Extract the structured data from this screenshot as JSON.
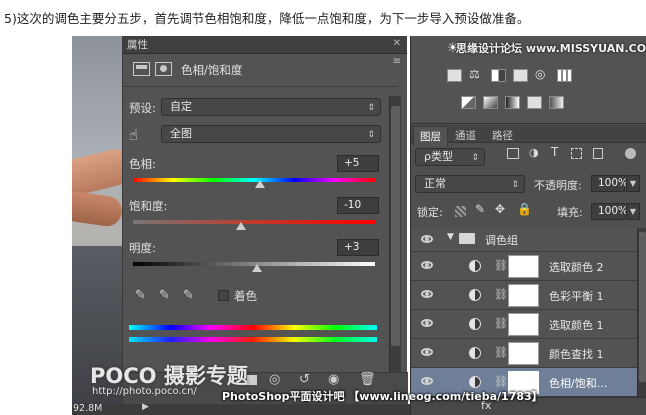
{
  "caption": "5)这次的调色主要分五步，首先调节色相饱和度，降低一点饱和度，为下一步导入预设做准备。",
  "properties_panel": {
    "title": "属性",
    "close": "✕",
    "menu": "≡",
    "adjustment_name": "色相/饱和度",
    "preset_label": "预设:",
    "preset_value": "自定",
    "channel_value": "全图",
    "hue_label": "色相:",
    "hue_value": "+5",
    "saturation_label": "饱和度:",
    "saturation_value": "-10",
    "lightness_label": "明度:",
    "lightness_value": "+3",
    "colorize_label": "着色"
  },
  "status": {
    "doc_size": "92.8M"
  },
  "right_panel": {
    "tabs": [
      "图层",
      "通道",
      "路径"
    ],
    "filter_label": "ρ类型",
    "blend_mode": "正常",
    "opacity_label": "不透明度:",
    "opacity_value": "100%",
    "lock_label": "锁定:",
    "fill_label": "填充:",
    "fill_value": "100%",
    "group_name": "调色组",
    "layers": [
      {
        "name": "选取颜色 2",
        "selected": false
      },
      {
        "name": "色彩平衡 1",
        "selected": false
      },
      {
        "name": "选取颜色 1",
        "selected": false
      },
      {
        "name": "颜色查找 1",
        "selected": false
      },
      {
        "name": "色相/饱和...",
        "selected": true
      }
    ]
  },
  "watermarks": {
    "top_right": "思缘设计论坛 www.MISSYUAN.COM",
    "poco_brand": "POCO 摄影专题",
    "poco_url": "http://photo.poco.cn/",
    "bottom": "PhotoShop平面设计吧  【www.lineog.com/tieba/1783】"
  },
  "colors": {
    "panel_bg": "#535353",
    "selected_layer": "#6e7f97"
  }
}
